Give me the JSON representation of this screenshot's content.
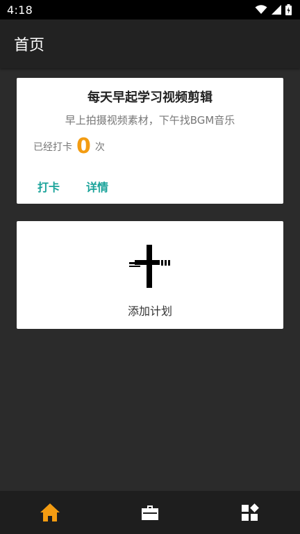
{
  "status_bar": {
    "time": "4:18",
    "icons": [
      "wifi-icon",
      "cell-signal-icon",
      "battery-icon"
    ]
  },
  "app_bar": {
    "title": "首页"
  },
  "plan_card": {
    "title": "每天早起学习视频剪辑",
    "description": "早上拍摄视频素材，下午找BGM音乐",
    "count_prefix": "已经打卡",
    "count_value": "0",
    "count_suffix": "次",
    "actions": [
      "打卡",
      "详情"
    ]
  },
  "add_card": {
    "label": "添加计划",
    "icon": "plus-icon"
  },
  "bottom_nav": {
    "items": [
      {
        "icon": "home-icon",
        "active": true
      },
      {
        "icon": "briefcase-icon",
        "active": false
      },
      {
        "icon": "widgets-icon",
        "active": false
      }
    ]
  },
  "colors": {
    "accent": "#f39c12",
    "action": "#1aa39a",
    "background": "#2b2b2b",
    "app_bar": "#222222",
    "card": "#ffffff"
  }
}
